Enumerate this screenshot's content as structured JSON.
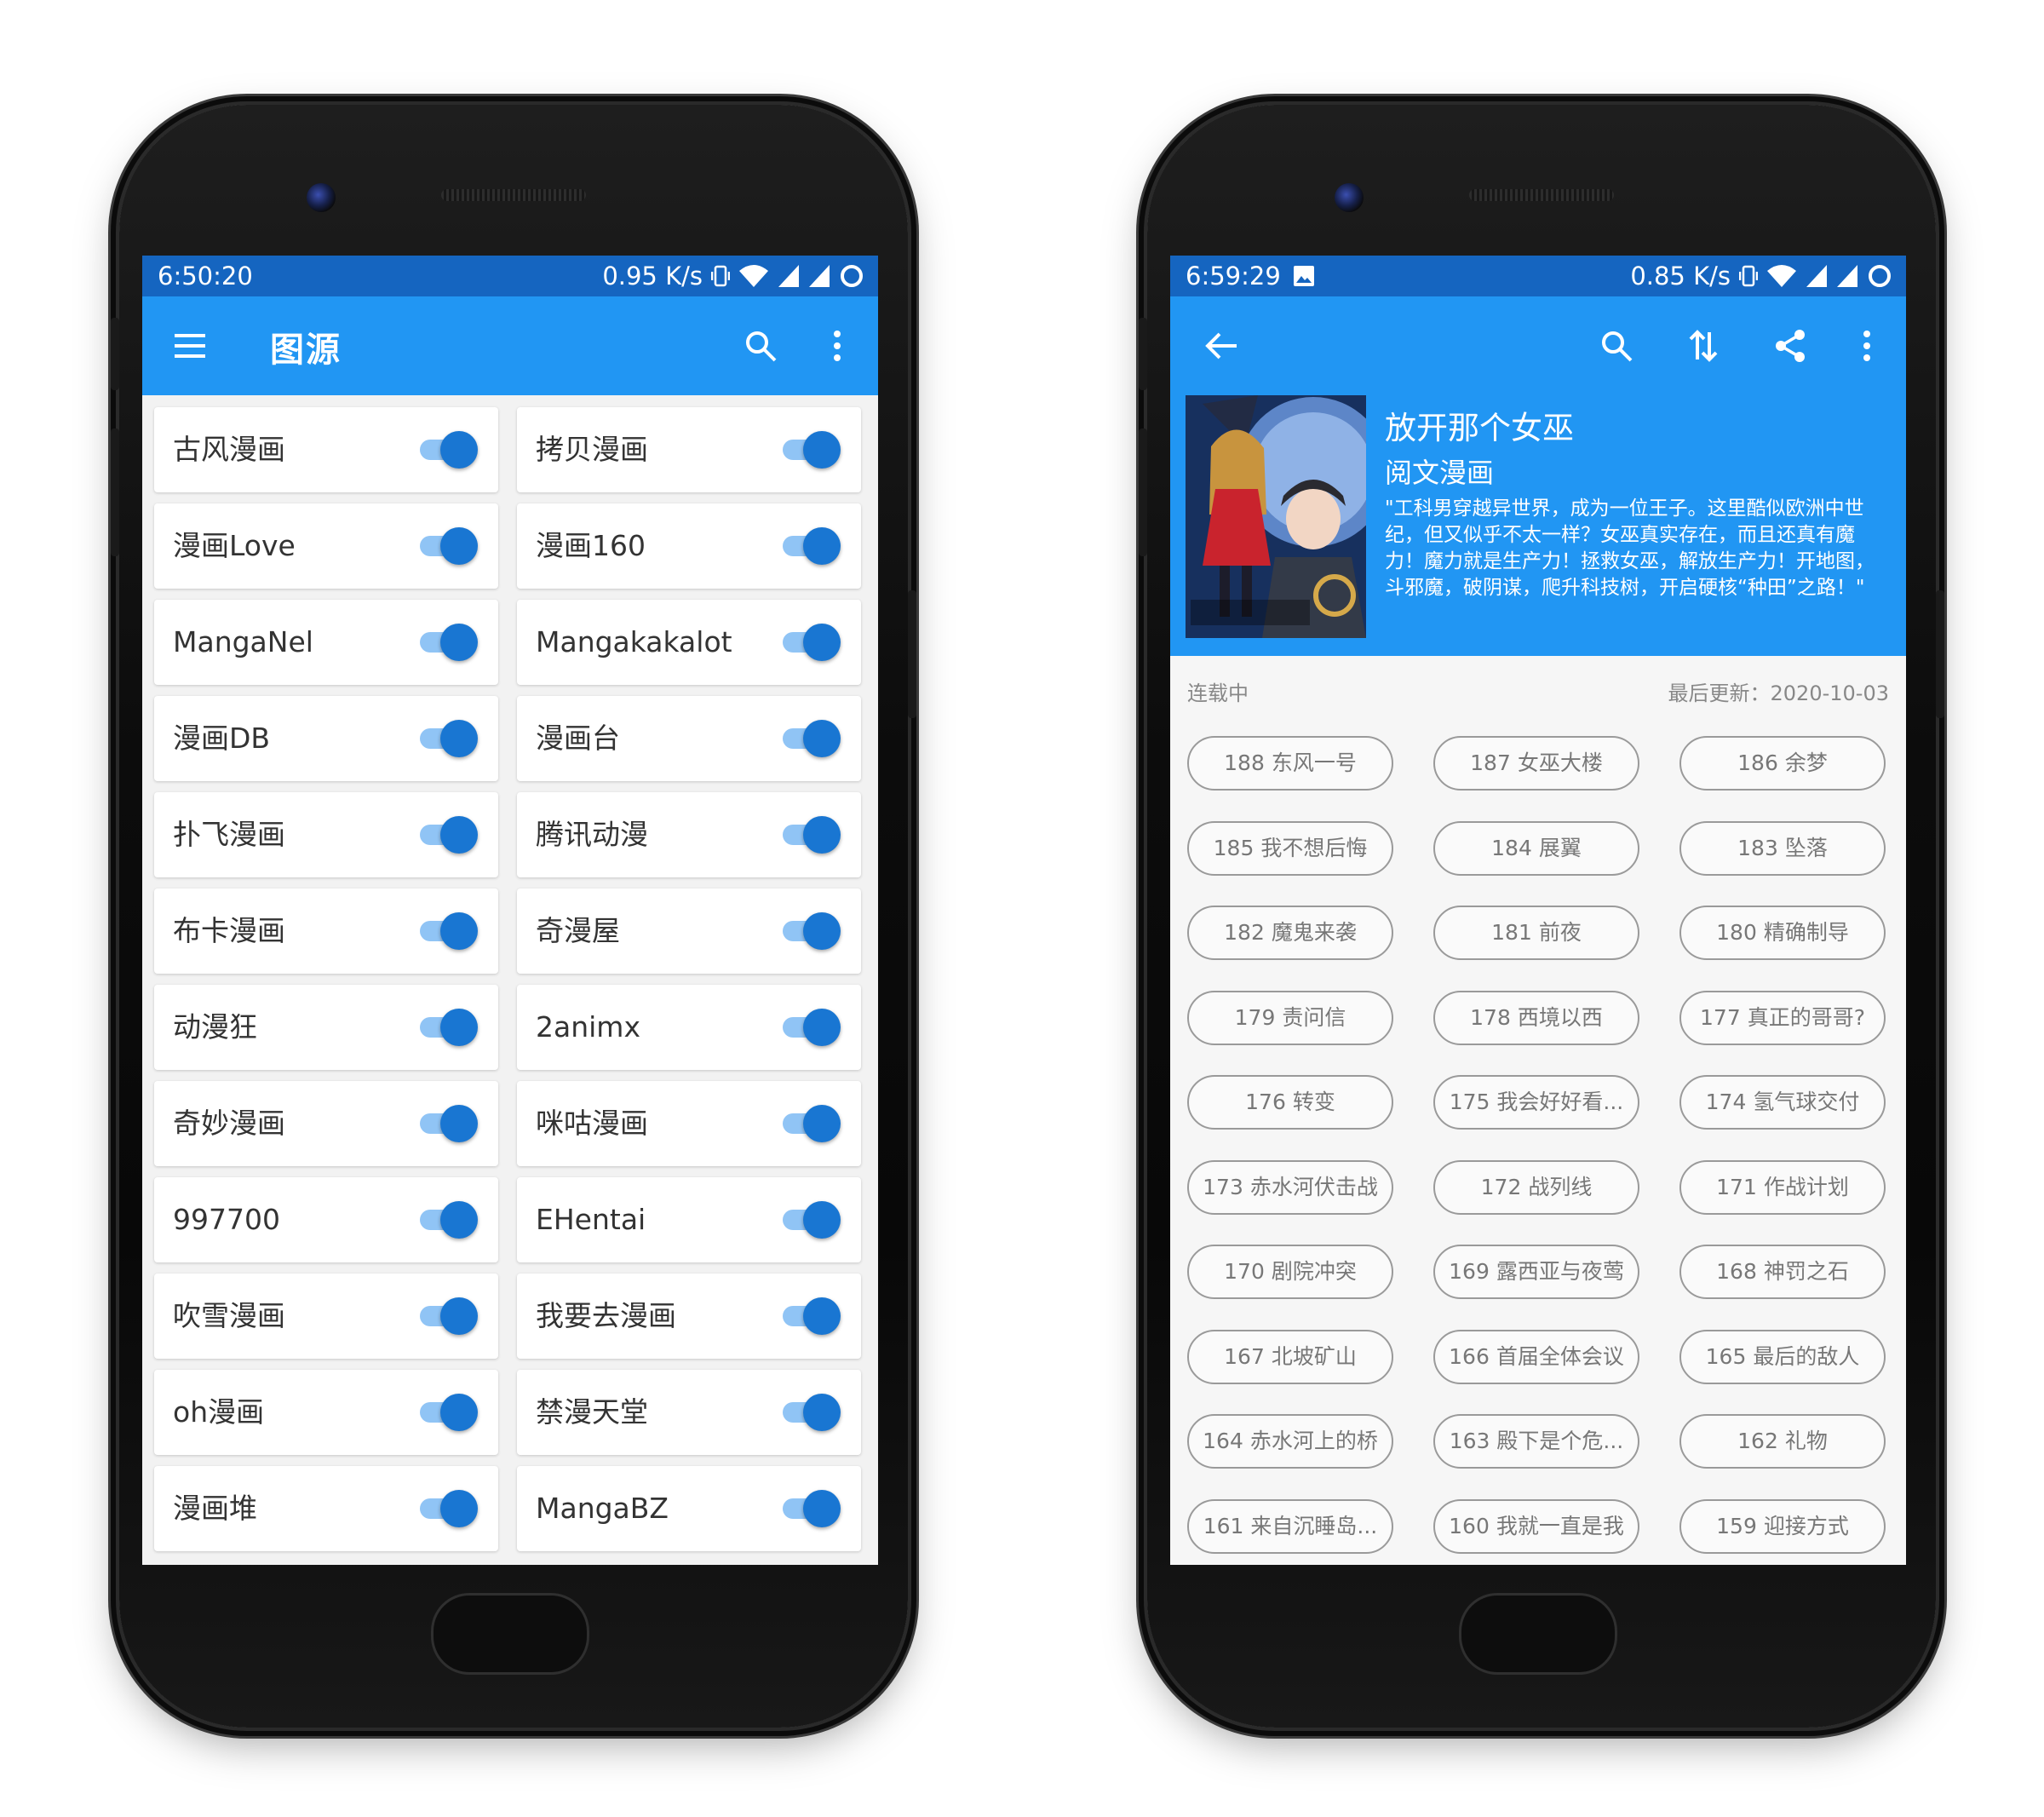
{
  "left_screen": {
    "status_bar": {
      "time": "6:50:20",
      "speed": "0.95 K/s"
    },
    "app_bar": {
      "menu_icon": "menu-icon",
      "title": "图源",
      "search_icon": "search-icon",
      "more_icon": "more-vert-icon"
    },
    "sources": [
      {
        "name": "古风漫画",
        "enabled": true
      },
      {
        "name": "拷贝漫画",
        "enabled": true
      },
      {
        "name": "漫画Love",
        "enabled": true
      },
      {
        "name": "漫画160",
        "enabled": true
      },
      {
        "name": "MangaNel",
        "enabled": true
      },
      {
        "name": "Mangakakalot",
        "enabled": true
      },
      {
        "name": "漫画DB",
        "enabled": true
      },
      {
        "name": "漫画台",
        "enabled": true
      },
      {
        "name": "扑飞漫画",
        "enabled": true
      },
      {
        "name": "腾讯动漫",
        "enabled": true
      },
      {
        "name": "布卡漫画",
        "enabled": true
      },
      {
        "name": "奇漫屋",
        "enabled": true
      },
      {
        "name": "动漫狂",
        "enabled": true
      },
      {
        "name": "2animx",
        "enabled": true
      },
      {
        "name": "奇妙漫画",
        "enabled": true
      },
      {
        "name": "咪咕漫画",
        "enabled": true
      },
      {
        "name": "997700",
        "enabled": true
      },
      {
        "name": "EHentai",
        "enabled": true
      },
      {
        "name": "吹雪漫画",
        "enabled": true
      },
      {
        "name": "我要去漫画",
        "enabled": true
      },
      {
        "name": "oh漫画",
        "enabled": true
      },
      {
        "name": "禁漫天堂",
        "enabled": true
      },
      {
        "name": "漫画堆",
        "enabled": true
      },
      {
        "name": "MangaBZ",
        "enabled": true
      }
    ]
  },
  "right_screen": {
    "status_bar": {
      "time": "6:59:29",
      "speed": "0.85 K/s"
    },
    "app_bar": {
      "back_icon": "arrow-back-icon",
      "search_icon": "search-icon",
      "sort_icon": "sort-icon",
      "share_icon": "share-icon",
      "more_icon": "more-vert-icon"
    },
    "comic": {
      "title": "放开那个女巫",
      "author": "阅文漫画",
      "intro": "\"工科男穿越异世界，成为一位王子。这里酷似欧洲中世纪，但又似乎不太一样？女巫真实存在，而且还真有魔力！魔力就是生产力！拯救女巫，解放生产力！开地图，斗邪魔，破阴谋，爬升科技树，开启硬核“种田”之路！\"",
      "status": "连载中",
      "last_update": "最后更新：2020-10-03"
    },
    "chapters": [
      "188 东风一号",
      "187 女巫大楼",
      "186 余梦",
      "185 我不想后悔",
      "184 展翼",
      "183 坠落",
      "182 魔鬼来袭",
      "181 前夜",
      "180 精确制导",
      "179 责问信",
      "178 西境以西",
      "177 真正的哥哥?",
      "176 转变",
      "175 我会好好看...",
      "174 氢气球交付",
      "173 赤水河伏击战",
      "172 战列线",
      "171 作战计划",
      "170 剧院冲突",
      "169 露西亚与夜莺",
      "168 神罚之石",
      "167 北坡矿山",
      "166 首届全体会议",
      "165 最后的敌人",
      "164 赤水河上的桥",
      "163 殿下是个危...",
      "162 礼物",
      "161 来自沉睡岛...",
      "160 我就一直是我",
      "159 迎接方式"
    ]
  },
  "colors": {
    "primary": "#2196f3",
    "primary_dark": "#1565c0",
    "switch_thumb": "#1976d2",
    "switch_track": "#90c4f5"
  }
}
